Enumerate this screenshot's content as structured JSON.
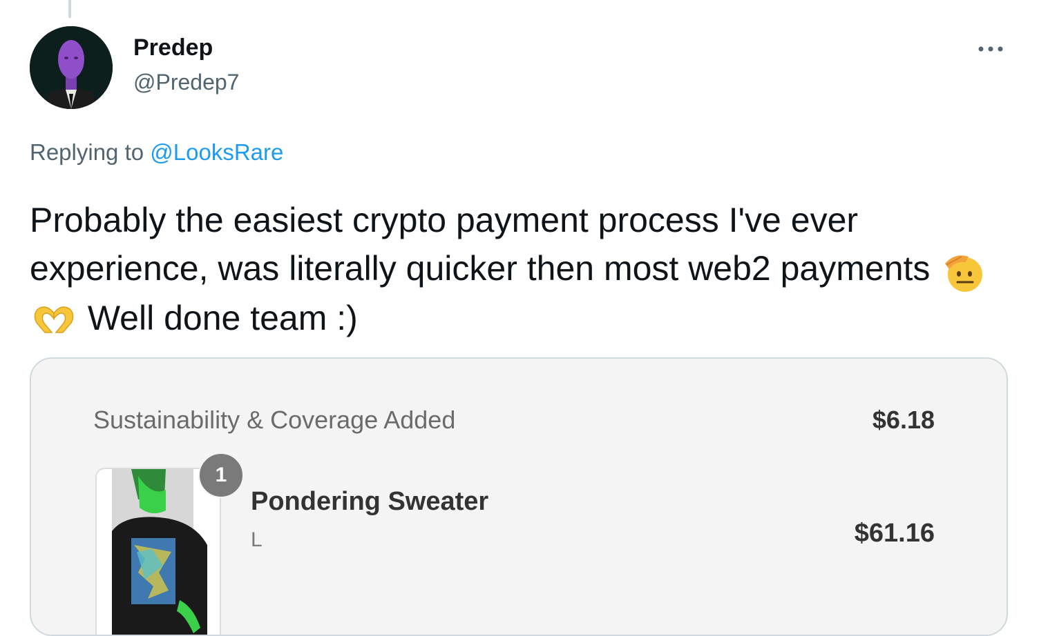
{
  "tweet": {
    "author_name": "Predep",
    "author_handle": "@Predep7",
    "replying_prefix": "Replying to",
    "replying_to": "@LooksRare",
    "text_part1": "Probably the easiest crypto payment process I've ever experience, was literally quicker then most web2 payments ",
    "emojis": [
      "saluting-face-icon",
      "heart-hands-icon"
    ],
    "text_part2": " Well done team :)",
    "more_icon": "more-options-icon"
  },
  "receipt": {
    "summary_label": "Sustainability & Coverage Added",
    "summary_amount": "$6.18",
    "item": {
      "quantity": "1",
      "name": "Pondering Sweater",
      "variant": "L",
      "price": "$61.16"
    }
  },
  "colors": {
    "link": "#1d9bf0",
    "secondary_text": "#536471",
    "card_bg": "#f4f4f4"
  }
}
